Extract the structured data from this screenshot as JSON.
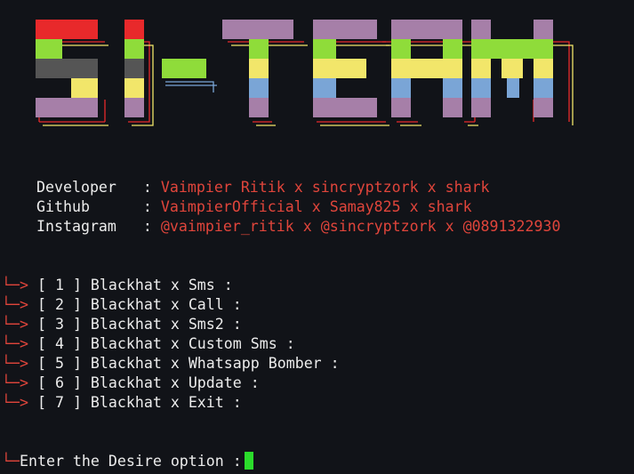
{
  "banner": {
    "title": "SI-TEAM",
    "colors": [
      "#e8292b",
      "#8fdc3a",
      "#555555",
      "#f2e66a",
      "#7aa5d6",
      "#a67fa8"
    ]
  },
  "info": [
    {
      "label": "Developer",
      "value": "Vaimpier Ritik x sincryptzork x shark"
    },
    {
      "label": "Github",
      "value": "VaimpierOfficial x Samay825 x shark"
    },
    {
      "label": "Instagram",
      "value": "@vaimpier_ritik x @sincryptzork x @0891322930"
    }
  ],
  "separator": ":",
  "arrow": "└─>",
  "menu": [
    "[ 1 ] Blackhat x Sms :",
    "[ 2 ] Blackhat x Call :",
    "[ 3 ] Blackhat x Sms2 :",
    "[ 4 ] Blackhat x Custom Sms :",
    "[ 5 ] Blackhat x Whatsapp Bomber :",
    "[ 6 ] Blackhat x Update :",
    "[ 7 ] Blackhat x Exit :"
  ],
  "prompt": {
    "corner": "└─",
    "text": "Enter the Desire option :"
  },
  "colors": {
    "accent_red": "#e0453b",
    "text": "#ececec",
    "cursor": "#2bdc2b",
    "background": "#111318"
  }
}
